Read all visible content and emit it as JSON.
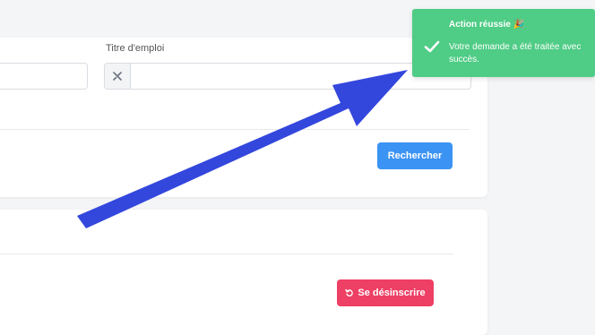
{
  "search_form": {
    "job_title_label": "Titre d'emploi",
    "job_title_value": "",
    "job_title_placeholder": "",
    "left_field_value": "",
    "search_button": "Rechercher"
  },
  "subscription": {
    "unsubscribe_button": "Se désinscrire"
  },
  "toast": {
    "title": "Action réussie 🎉",
    "message": "Votre demande a été traitée avec succès.",
    "color": "#4fcc85"
  },
  "annotation": {
    "arrow_color": "#3347dd"
  },
  "colors": {
    "primary": "#3b93f3",
    "danger": "#ee3f64"
  }
}
